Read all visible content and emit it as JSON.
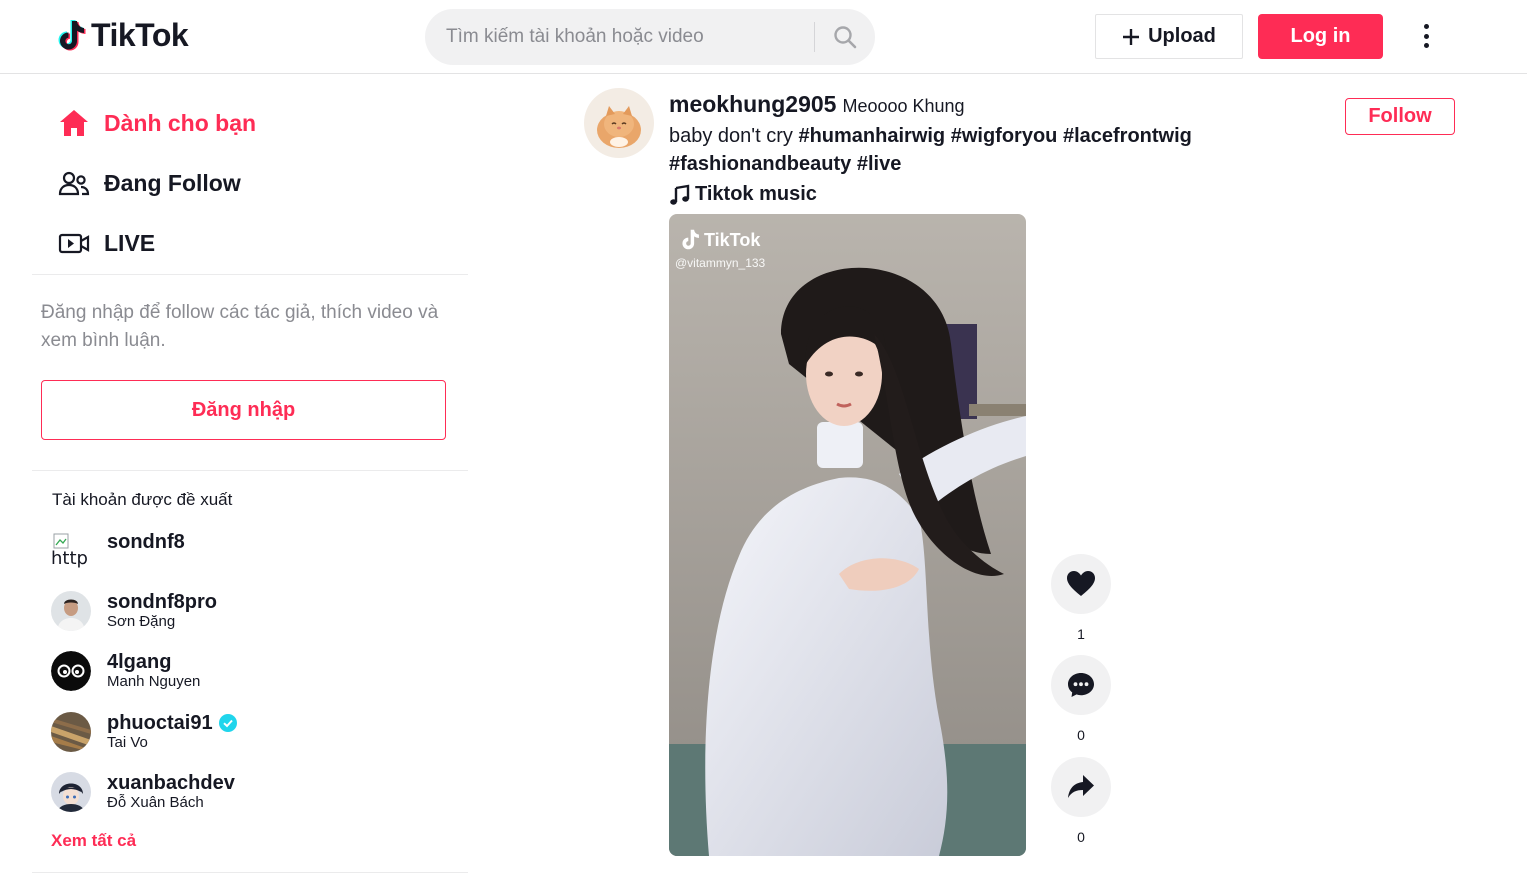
{
  "header": {
    "logo_text": "TikTok",
    "search_placeholder": "Tìm kiếm tài khoản hoặc video",
    "upload_label": "Upload",
    "login_label": "Log in"
  },
  "sidebar": {
    "nav": [
      {
        "label": "Dành cho bạn",
        "icon": "home-icon"
      },
      {
        "label": "Đang Follow",
        "icon": "users-icon"
      },
      {
        "label": "LIVE",
        "icon": "live-icon"
      }
    ],
    "login_hint": "Đăng nhập để follow các tác giả, thích video và xem bình luận.",
    "login_button": "Đăng nhập",
    "suggested_title": "Tài khoản được đề xuất",
    "accounts": [
      {
        "username": "sondnf8",
        "nickname": "",
        "avatar_alt": "http"
      },
      {
        "username": "sondnf8pro",
        "nickname": "Sơn Đặng"
      },
      {
        "username": "4lgang",
        "nickname": "Manh Nguyen"
      },
      {
        "username": "phuoctai91",
        "nickname": "Tai Vo",
        "verified": true
      },
      {
        "username": "xuanbachdev",
        "nickname": "Đỗ Xuân Bách"
      }
    ],
    "see_all": "Xem tất cả"
  },
  "post": {
    "username": "meokhung2905",
    "nickname": "Meoooo Khung",
    "caption_text": "baby don't cry",
    "hashtags": [
      "#humanhairwig",
      "#wigforyou",
      "#lacefrontwig",
      "#fashionandbeauty",
      "#live"
    ],
    "music": "Tiktok music",
    "follow_label": "Follow",
    "video_watermark": "TikTok",
    "video_watermark_user": "@vitammyn_133",
    "likes": "1",
    "comments": "0",
    "shares": "0"
  },
  "colors": {
    "accent": "#fe2c55",
    "text": "#161823",
    "muted": "#8a8b91",
    "verified": "#20d5ec"
  }
}
